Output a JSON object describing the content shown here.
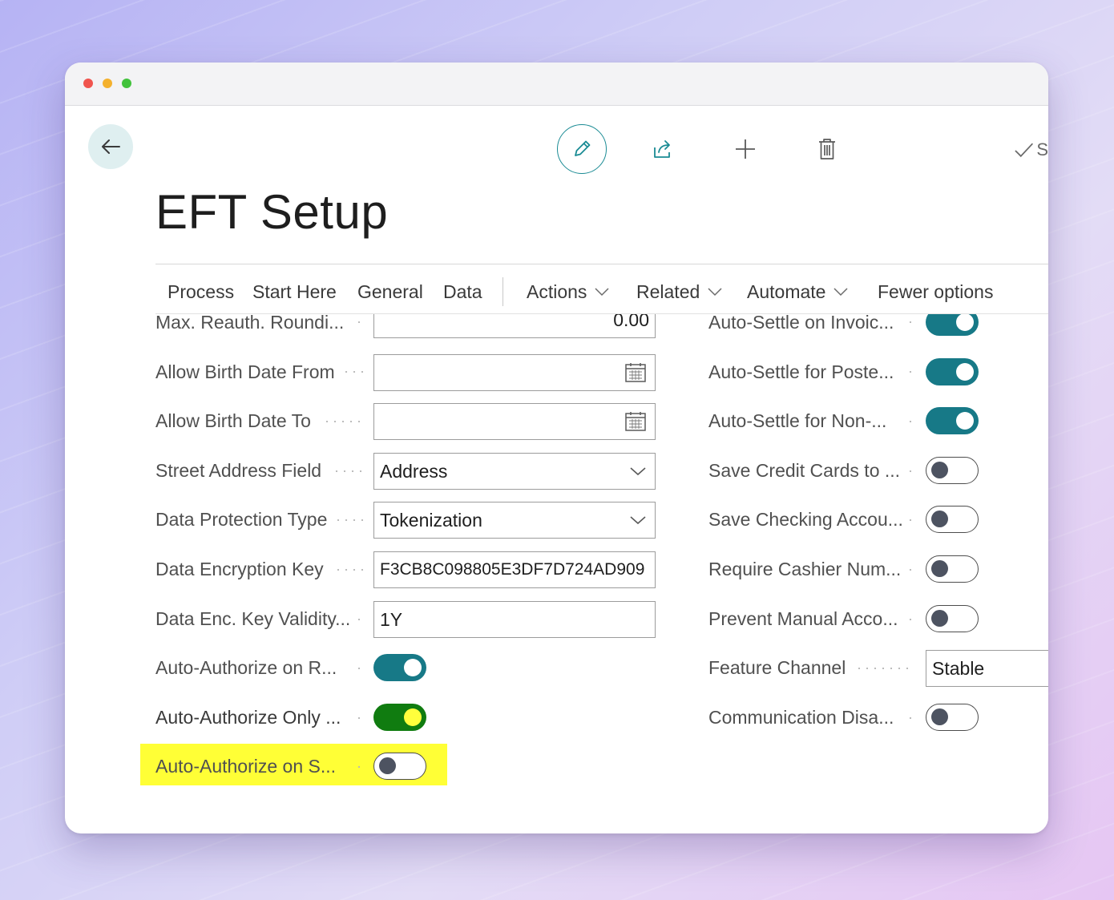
{
  "window": {
    "traffic_lights": [
      "close",
      "minimize",
      "maximize"
    ]
  },
  "toolbar": {
    "back_icon": "arrow-left-icon",
    "edit_icon": "pencil-icon",
    "share_icon": "share-icon",
    "add_icon": "plus-icon",
    "delete_icon": "trash-icon",
    "saved_partial": "S"
  },
  "page": {
    "title": "EFT Setup"
  },
  "nav": {
    "items": [
      {
        "label": "Process"
      },
      {
        "label": "Start Here"
      },
      {
        "label": "General"
      },
      {
        "label": "Data"
      },
      {
        "label": "Actions"
      },
      {
        "label": "Related"
      },
      {
        "label": "Automate"
      },
      {
        "label": "Fewer options"
      }
    ]
  },
  "left_fields": [
    {
      "label": "Max. Reauth. Roundi...",
      "value": "0.00"
    },
    {
      "label": "Allow Birth Date From",
      "value": ""
    },
    {
      "label": "Allow Birth Date To",
      "value": ""
    },
    {
      "label": "Street Address Field",
      "value": "Address"
    },
    {
      "label": "Data Protection Type",
      "value": "Tokenization"
    },
    {
      "label": "Data Encryption Key",
      "value": "F3CB8C098805E3DF7D724AD909"
    },
    {
      "label": "Data Enc. Key Validity...",
      "value": "1Y"
    },
    {
      "label": "Auto-Authorize on R...",
      "toggle": true
    },
    {
      "label": "Auto-Authorize Only ...",
      "toggle": true,
      "highlighted": true
    },
    {
      "label": "Auto-Authorize on S...",
      "toggle": false
    }
  ],
  "right_fields": [
    {
      "label": "Auto-Settle on Invoic...",
      "toggle": true
    },
    {
      "label": "Auto-Settle for Poste...",
      "toggle": true
    },
    {
      "label": "Auto-Settle for Non-...",
      "toggle": true
    },
    {
      "label": "Save Credit Cards to ...",
      "toggle": false
    },
    {
      "label": "Save Checking Accou...",
      "toggle": false
    },
    {
      "label": "Require Cashier Num...",
      "toggle": false
    },
    {
      "label": "Prevent Manual Acco...",
      "toggle": false
    },
    {
      "label": "Feature Channel",
      "value": "Stable"
    },
    {
      "label": "Communication Disa...",
      "toggle": false
    }
  ],
  "colors": {
    "accent": "#177987",
    "highlight": "#ffff36",
    "toggle_highlight_on": "#107c10"
  }
}
